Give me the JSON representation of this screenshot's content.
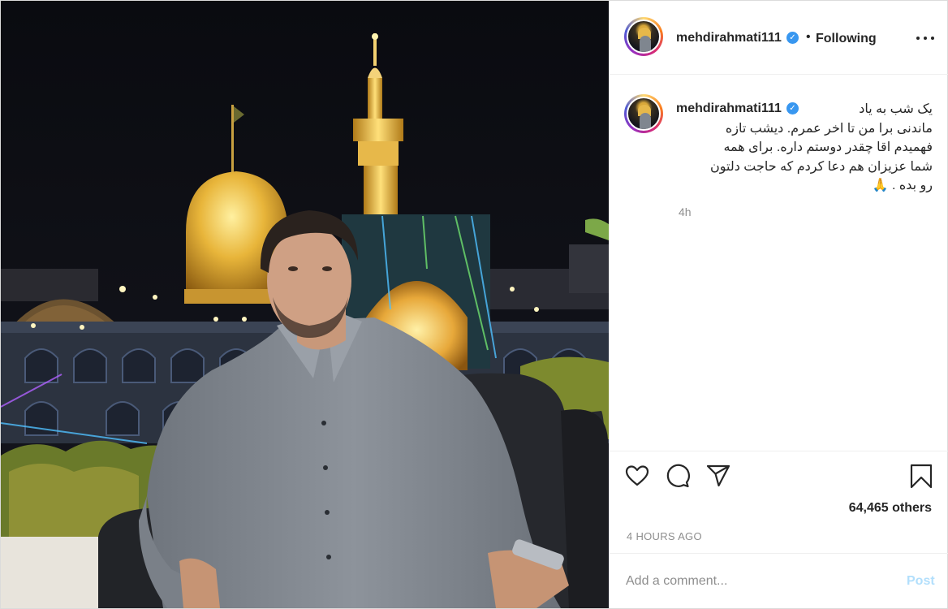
{
  "post": {
    "username": "mehdirahmati111",
    "verified_icon": "verified-badge-icon",
    "separator": "•",
    "follow_status": "Following",
    "caption_lines": [
      "یک شب به یاد",
      "ماندنی برا من تا اخر عمرم. دیشب تازه",
      "فهمیدم اقا چقدر دوستم داره. برای همه",
      "شما عزیزان هم دعا کردم که حاجت دلتون",
      "رو بده . 🙏"
    ],
    "caption_time": "4h",
    "likes": "64,465 others",
    "time_ago": "4 HOURS AGO",
    "comment_placeholder": "Add a comment...",
    "post_label": "Post"
  },
  "icons": {
    "like": "heart-icon",
    "comment": "comment-icon",
    "share": "share-icon",
    "save": "bookmark-icon",
    "more": "more-options-icon"
  },
  "colors": {
    "accent": "#3897f0",
    "post_button_disabled": "#b2dffc",
    "muted_text": "#8e8e8e",
    "gold": "#e8b53a"
  }
}
